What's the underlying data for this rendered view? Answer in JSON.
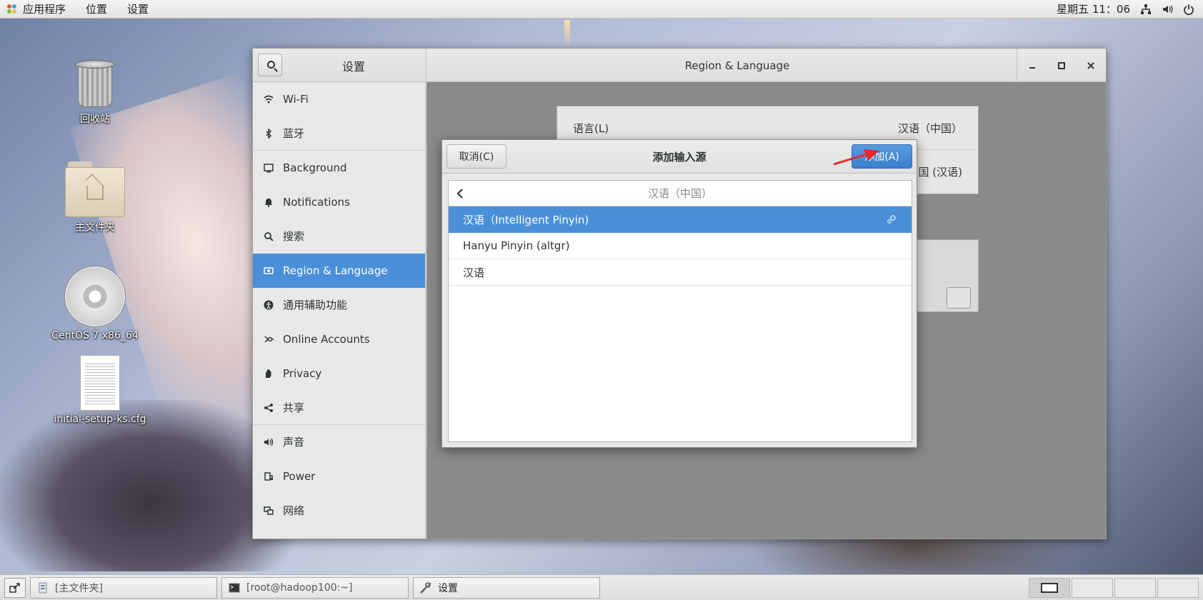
{
  "topbar": {
    "menus": [
      "应用程序",
      "位置",
      "设置"
    ],
    "clock": "星期五 11：06"
  },
  "desktop": {
    "icons": [
      {
        "label": "回收站",
        "icon": "trash-icon"
      },
      {
        "label": "主文件夹",
        "icon": "home-folder-icon"
      },
      {
        "label": "CentOS 7 x86_64",
        "icon": "cdrom-icon"
      },
      {
        "label": "initial-setup-ks.cfg",
        "icon": "text-file-icon"
      }
    ]
  },
  "settings": {
    "sidebar_title": "设置",
    "page_title": "Region & Language",
    "sidebar": [
      {
        "label": "Wi-Fi",
        "icon": "wifi-icon"
      },
      {
        "label": "蓝牙",
        "icon": "bluetooth-icon"
      },
      {
        "label": "Background",
        "icon": "background-icon"
      },
      {
        "label": "Notifications",
        "icon": "bell-icon"
      },
      {
        "label": "搜索",
        "icon": "search-icon"
      },
      {
        "label": "Region & Language",
        "icon": "region-icon",
        "active": true
      },
      {
        "label": "通用辅助功能",
        "icon": "accessibility-icon"
      },
      {
        "label": "Online Accounts",
        "icon": "online-accounts-icon"
      },
      {
        "label": "Privacy",
        "icon": "privacy-hand-icon"
      },
      {
        "label": "共享",
        "icon": "share-icon"
      },
      {
        "label": "声音",
        "icon": "speaker-icon"
      },
      {
        "label": "Power",
        "icon": "power-icon"
      },
      {
        "label": "网络",
        "icon": "network-icon"
      }
    ],
    "content": {
      "language_label": "语言(L)",
      "language_value": "汉语（中国）",
      "formats_value_partial": "国 (汉语)"
    }
  },
  "dialog": {
    "title": "添加输入源",
    "cancel_label": "取消(C)",
    "add_label": "添加(A)",
    "list_header": "汉语（中国）",
    "items": [
      {
        "label": "汉语（Intelligent Pinyin)",
        "selected": true
      },
      {
        "label": "Hanyu Pinyin (altgr)"
      },
      {
        "label": "汉语"
      }
    ]
  },
  "taskbar": {
    "tasks": [
      {
        "label": "[主文件夹]",
        "icon": "file-manager-icon"
      },
      {
        "label": "[root@hadoop100:~]",
        "icon": "terminal-icon"
      },
      {
        "label": "设置",
        "icon": "settings-tools-icon"
      }
    ]
  },
  "colors": {
    "accent": "#4a90d9",
    "arrow": "#e8262a"
  }
}
